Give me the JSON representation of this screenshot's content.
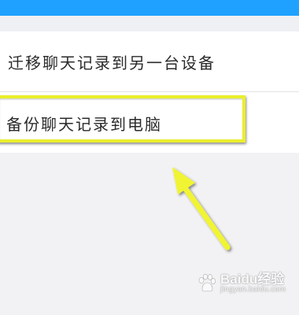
{
  "colors": {
    "top_bar": "#1ea1ff",
    "highlight": "#e9ef2c",
    "arrow": "#f0f430"
  },
  "menu": {
    "items": [
      {
        "label": "迁移聊天记录到另一台设备"
      },
      {
        "label": "备份聊天记录到电脑"
      }
    ]
  },
  "annotation": {
    "arrow_icon": "arrow-up-left-icon"
  },
  "watermark": {
    "text": "Baidu经验",
    "subtext": "jingyan.baidu.com",
    "logo_icon": "baidu-paw-icon"
  }
}
